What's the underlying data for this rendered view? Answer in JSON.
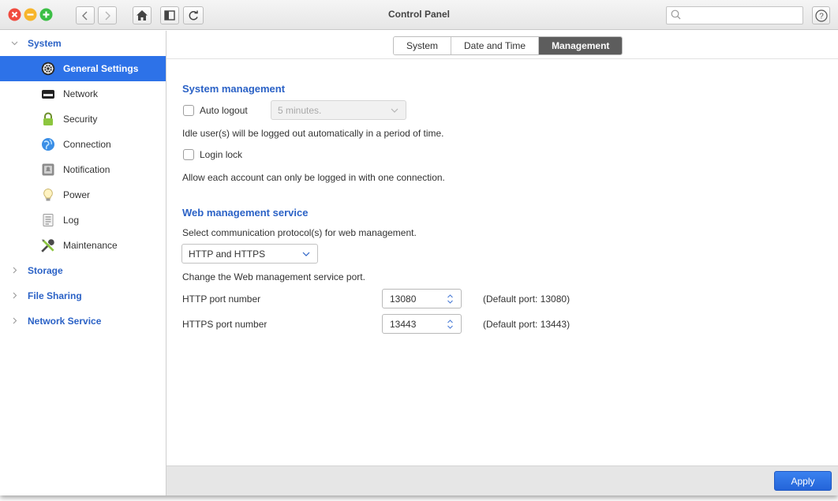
{
  "window": {
    "title": "Control Panel"
  },
  "search": {
    "placeholder": "",
    "value": ""
  },
  "sidebar": {
    "categories": [
      {
        "label": "System",
        "expanded": true
      },
      {
        "label": "Storage",
        "expanded": false
      },
      {
        "label": "File Sharing",
        "expanded": false
      },
      {
        "label": "Network Service",
        "expanded": false
      }
    ],
    "items": [
      {
        "label": "General Settings",
        "icon": "gear-icon",
        "active": true
      },
      {
        "label": "Network",
        "icon": "network-card-icon"
      },
      {
        "label": "Security",
        "icon": "lock-icon"
      },
      {
        "label": "Connection",
        "icon": "globe-icon"
      },
      {
        "label": "Notification",
        "icon": "notification-icon"
      },
      {
        "label": "Power",
        "icon": "lightbulb-icon"
      },
      {
        "label": "Log",
        "icon": "log-icon"
      },
      {
        "label": "Maintenance",
        "icon": "tools-icon"
      }
    ]
  },
  "tabs": [
    {
      "label": "System",
      "active": false
    },
    {
      "label": "Date and Time",
      "active": false
    },
    {
      "label": "Management",
      "active": true
    }
  ],
  "system_management": {
    "heading": "System management",
    "auto_logout": {
      "label": "Auto logout",
      "checked": false,
      "select_value": "5 minutes.",
      "disabled": true
    },
    "auto_logout_desc": "Idle user(s) will be logged out automatically in a period of time.",
    "login_lock": {
      "label": "Login lock",
      "checked": false
    },
    "login_lock_desc": "Allow each account can only be logged in with one connection."
  },
  "web_management": {
    "heading": "Web management service",
    "protocol_desc": "Select communication protocol(s) for web management.",
    "protocol_value": "HTTP and HTTPS",
    "port_desc": "Change the Web management service port.",
    "http": {
      "label": "HTTP port number",
      "value": "13080",
      "default_note": "(Default port: 13080)"
    },
    "https": {
      "label": "HTTPS port number",
      "value": "13443",
      "default_note": "(Default port: 13443)"
    }
  },
  "footer": {
    "apply_label": "Apply"
  },
  "colors": {
    "accent": "#2d72e8",
    "heading": "#2b62c6",
    "tab_active": "#5d5d5d"
  }
}
